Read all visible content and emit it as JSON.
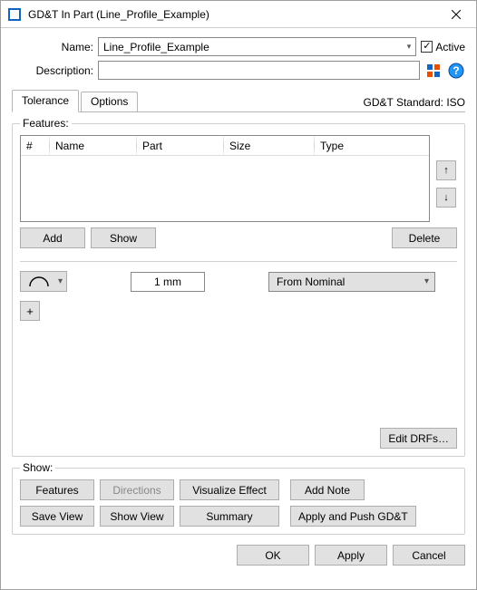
{
  "window": {
    "title": "GD&T In Part (Line_Profile_Example)"
  },
  "header": {
    "name_label": "Name:",
    "name_value": "Line_Profile_Example",
    "desc_label": "Description:",
    "desc_value": "",
    "active_label": "Active",
    "active_checked": "✓"
  },
  "tabs": {
    "tolerance": "Tolerance",
    "options": "Options",
    "standard_label": "GD&T Standard: ISO"
  },
  "features": {
    "legend": "Features:",
    "cols": {
      "num": "#",
      "name": "Name",
      "part": "Part",
      "size": "Size",
      "type": "Type"
    },
    "add": "Add",
    "show": "Show",
    "delete": "Delete",
    "up": "↑",
    "down": "↓"
  },
  "tolerance": {
    "value": "1 mm",
    "from": "From Nominal",
    "plus": "+",
    "edit_drfs": "Edit DRFs…"
  },
  "show": {
    "legend": "Show:",
    "features": "Features",
    "directions": "Directions",
    "visualize": "Visualize Effect",
    "add_note": "Add Note",
    "save_view": "Save View",
    "show_view": "Show View",
    "summary": "Summary",
    "apply_push": "Apply and Push GD&T"
  },
  "footer": {
    "ok": "OK",
    "apply": "Apply",
    "cancel": "Cancel"
  }
}
